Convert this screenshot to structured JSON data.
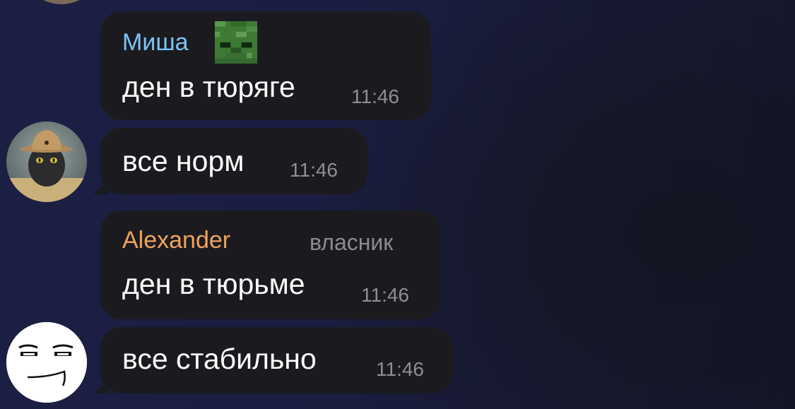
{
  "messages": [
    {
      "sender": "Миша",
      "sender_color": "#7cc4f8",
      "sender_icon": "zombie-face-icon",
      "text": "ден в тюряге",
      "time": "11:46"
    },
    {
      "text": "все норм",
      "time": "11:46",
      "avatar": "cowboy-cat-avatar"
    },
    {
      "sender": "Alexander",
      "sender_color": "#f0a35e",
      "role": "власник",
      "text": "ден в тюрьме",
      "time": "11:46"
    },
    {
      "text": "все стабильно",
      "time": "11:46",
      "avatar": "meme-face-avatar"
    }
  ],
  "colors": {
    "bubble": "#1b1b1f",
    "background": "#1c1f44",
    "time": "#8e8e93"
  }
}
